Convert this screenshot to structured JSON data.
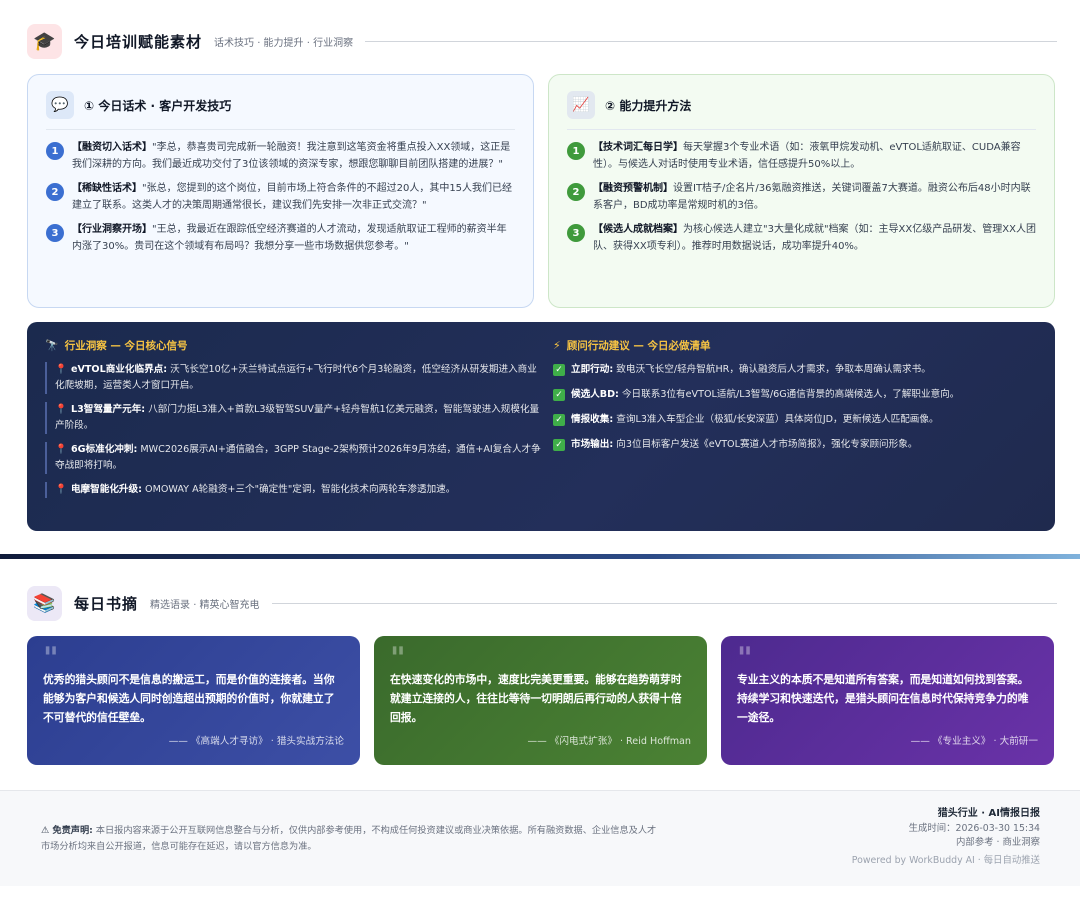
{
  "training": {
    "icon": "graduation-cap-icon",
    "title": "今日培训赋能素材",
    "subtitle": "话术技巧 · 能力提升 · 行业洞察"
  },
  "scripts_card": {
    "icon": "speech-bubble-icon",
    "title": "① 今日话术 · 客户开发技巧",
    "items": [
      {
        "n": "1",
        "tag": "【融资切入话术】",
        "text": "\"李总，恭喜贵司完成新一轮融资！我注意到这笔资金将重点投入XX领域，这正是我们深耕的方向。我们最近成功交付了3位该领域的资深专家，想跟您聊聊目前团队搭建的进展？\""
      },
      {
        "n": "2",
        "tag": "【稀缺性话术】",
        "text": "\"张总，您提到的这个岗位，目前市场上符合条件的不超过20人，其中15人我们已经建立了联系。这类人才的决策周期通常很长，建议我们先安排一次非正式交流？\""
      },
      {
        "n": "3",
        "tag": "【行业洞察开场】",
        "text": "\"王总，我最近在跟踪低空经济赛道的人才流动，发现适航取证工程师的薪资半年内涨了30%。贵司在这个领域有布局吗？我想分享一些市场数据供您参考。\""
      }
    ]
  },
  "skills_card": {
    "icon": "chart-trend-icon",
    "title": "② 能力提升方法",
    "items": [
      {
        "n": "1",
        "tag": "【技术词汇每日学】",
        "text": "每天掌握3个专业术语（如：液氧甲烷发动机、eVTOL适航取证、CUDA兼容性）。与候选人对话时使用专业术语，信任感提升50%以上。"
      },
      {
        "n": "2",
        "tag": "【融资预警机制】",
        "text": "设置IT桔子/企名片/36氪融资推送，关键词覆盖7大赛道。融资公布后48小时内联系客户，BD成功率是常规时机的3倍。"
      },
      {
        "n": "3",
        "tag": "【候选人成就档案】",
        "text": "为核心候选人建立\"3大量化成就\"档案（如：主导XX亿级产品研发、管理XX人团队、获得XX项专利）。推荐时用数据说话，成功率提升40%。"
      }
    ]
  },
  "insight": {
    "icon": "telescope-icon",
    "title": "行业洞察 — 今日核心信号",
    "items": [
      {
        "tag": "eVTOL商业化临界点:",
        "text": "沃飞长空10亿+沃兰特试点运行+飞行时代6个月3轮融资，低空经济从研发期进入商业化爬坡期，运营类人才窗口开启。"
      },
      {
        "tag": "L3智驾量产元年:",
        "text": "八部门力挺L3准入+首款L3级智驾SUV量产+轻舟智航1亿美元融资，智能驾驶进入规模化量产阶段。"
      },
      {
        "tag": "6G标准化冲刺:",
        "text": "MWC2026展示AI+通信融合，3GPP Stage-2架构预计2026年9月冻结，通信+AI复合人才争夺战即将打响。"
      },
      {
        "tag": "电摩智能化升级:",
        "text": "OMOWAY A轮融资+三个\"确定性\"定调，智能化技术向两轮车渗透加速。"
      }
    ]
  },
  "advice": {
    "icon": "lightning-icon",
    "title": "顾问行动建议 — 今日必做清单",
    "items": [
      {
        "tag": "立即行动:",
        "text": "致电沃飞长空/轻舟智航HR，确认融资后人才需求，争取本周确认需求书。"
      },
      {
        "tag": "候选人BD:",
        "text": "今日联系3位有eVTOL适航/L3智驾/6G通信背景的高端候选人，了解职业意向。"
      },
      {
        "tag": "情报收集:",
        "text": "查询L3准入车型企业（极狐/长安深蓝）具体岗位JD，更新候选人匹配画像。"
      },
      {
        "tag": "市场输出:",
        "text": "向3位目标客户发送《eVTOL赛道人才市场简报》，强化专家顾问形象。"
      }
    ]
  },
  "books": {
    "icon": "books-icon",
    "title": "每日书摘",
    "subtitle": "精选语录 · 精英心智充电",
    "quotes": [
      {
        "text": "优秀的猎头顾问不是信息的搬运工，而是价值的连接者。当你能够为客户和候选人同时创造超出预期的价值时，你就建立了不可替代的信任壁垒。",
        "source": "—— 《高端人才寻访》 · 猎头实战方法论"
      },
      {
        "text": "在快速变化的市场中，速度比完美更重要。能够在趋势萌芽时就建立连接的人，往往比等待一切明朗后再行动的人获得十倍回报。",
        "source": "—— 《闪电式扩张》 · Reid Hoffman"
      },
      {
        "text": "专业主义的本质不是知道所有答案，而是知道如何找到答案。持续学习和快速迭代，是猎头顾问在信息时代保持竞争力的唯一途径。",
        "source": "—— 《专业主义》 · 大前研一"
      }
    ]
  },
  "footer": {
    "disclaimer_label": "⚠ 免责声明:",
    "disclaimer": "本日报内容来源于公开互联网信息整合与分析，仅供内部参考使用，不构成任何投资建议或商业决策依据。所有融资数据、企业信息及人才市场分析均来自公开报道，信息可能存在延迟，请以官方信息为准。",
    "brand": "猎头行业 · AI情报日报",
    "generated": "生成时间：2026-03-30 15:34",
    "scope": "内部参考 · 商业洞察",
    "powered": "Powered by WorkBuddy AI · 每日自动推送"
  }
}
